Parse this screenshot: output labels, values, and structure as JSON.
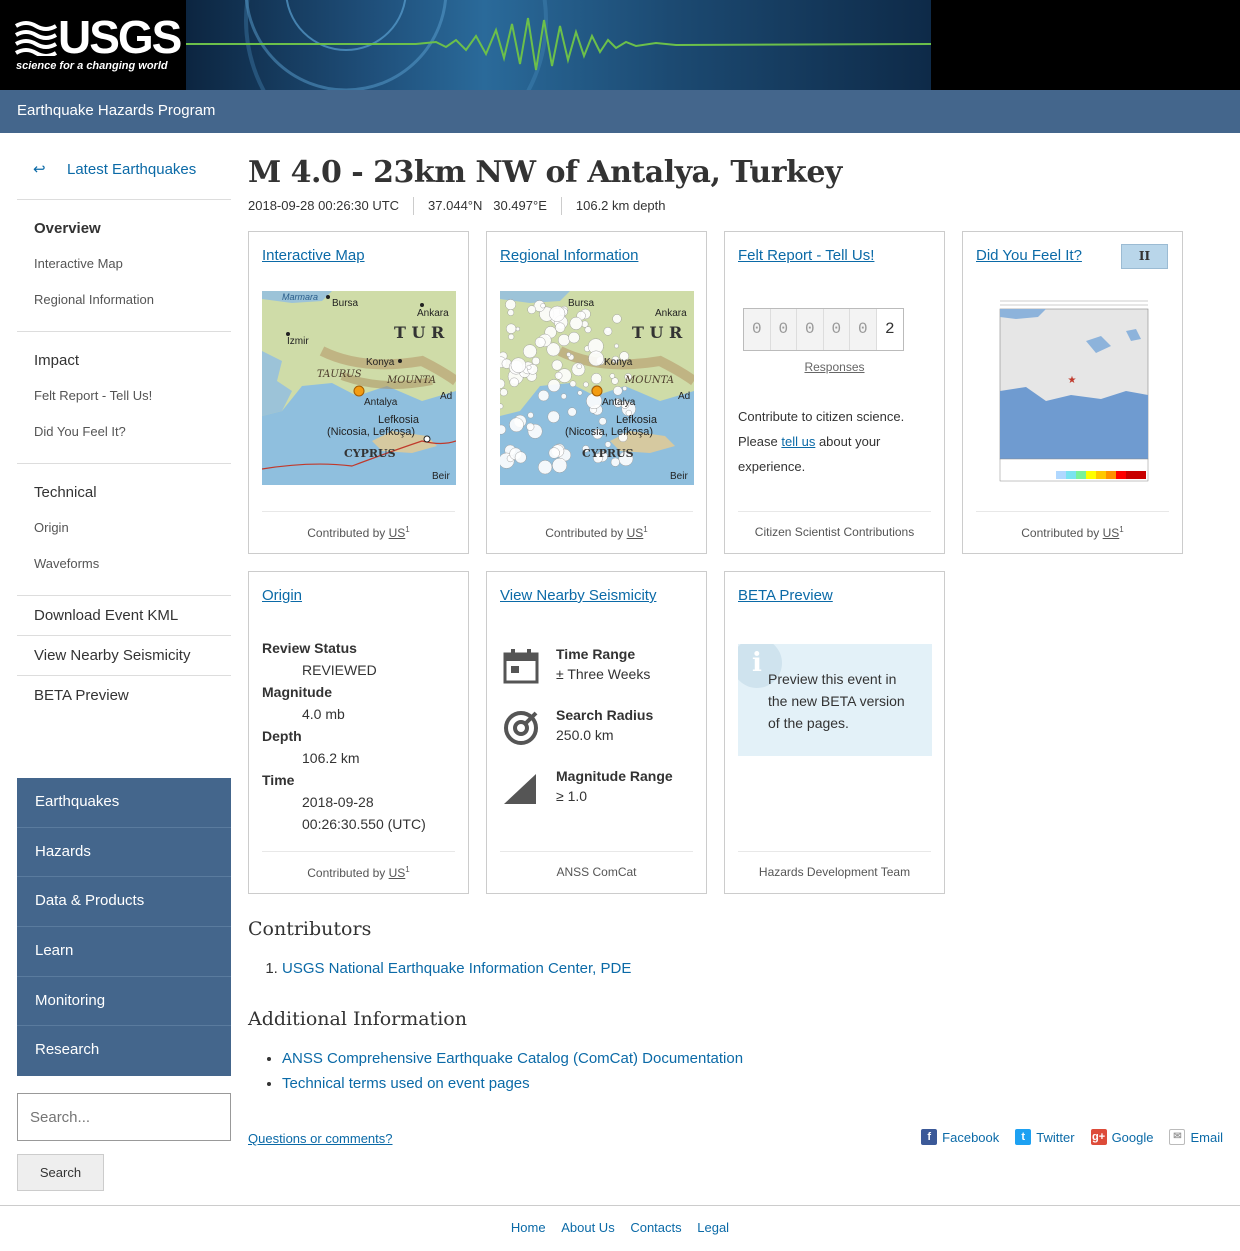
{
  "header": {
    "logo": "USGS",
    "tagline": "science for a changing world",
    "program": "Earthquake Hazards Program"
  },
  "sidebar": {
    "back_label": "Latest Earthquakes",
    "overview": "Overview",
    "overview_items": [
      "Interactive Map",
      "Regional Information"
    ],
    "impact": "Impact",
    "impact_items": [
      "Felt Report - Tell Us!",
      "Did You Feel It?"
    ],
    "technical": "Technical",
    "technical_items": [
      "Origin",
      "Waveforms"
    ],
    "download_kml": "Download Event KML",
    "nearby": "View Nearby Seismicity",
    "beta": "BETA Preview",
    "main_nav": [
      "Earthquakes",
      "Hazards",
      "Data & Products",
      "Learn",
      "Monitoring",
      "Research"
    ],
    "search_placeholder": "Search...",
    "search_button": "Search"
  },
  "event": {
    "title": "M 4.0 - 23km NW of Antalya, Turkey",
    "time": "2018-09-28 00:26:30 UTC",
    "location": "37.044°N   30.497°E",
    "depth": "106.2 km depth"
  },
  "cards": {
    "interactive_map": {
      "title": "Interactive Map",
      "footer_prefix": "Contributed by ",
      "footer_net": "US",
      "footer_sup": "1"
    },
    "regional": {
      "title": "Regional Information",
      "footer_prefix": "Contributed by ",
      "footer_net": "US",
      "footer_sup": "1"
    },
    "felt": {
      "title": "Felt Report - Tell Us!",
      "digits": [
        "0",
        "0",
        "0",
        "0",
        "0",
        "2"
      ],
      "responses_label": "Responses",
      "text_before": "Contribute to citizen science. Please ",
      "link": "tell us",
      "text_after": " about your experience.",
      "footer": "Citizen Scientist Contributions"
    },
    "dyfi": {
      "title": "Did You Feel It?",
      "badge": "II",
      "footer_prefix": "Contributed by ",
      "footer_net": "US",
      "footer_sup": "1"
    },
    "origin": {
      "title": "Origin",
      "review_label": "Review Status",
      "review_value": "REVIEWED",
      "mag_label": "Magnitude",
      "mag_value": "4.0 mb",
      "depth_label": "Depth",
      "depth_value": "106.2 km",
      "time_label": "Time",
      "time_value_1": "2018-09-28",
      "time_value_2": "00:26:30.550 (UTC)",
      "footer_prefix": "Contributed by ",
      "footer_net": "US",
      "footer_sup": "1"
    },
    "nearby": {
      "title": "View Nearby Seismicity",
      "time_range_label": "Time Range",
      "time_range_value": "± Three Weeks",
      "radius_label": "Search Radius",
      "radius_value": "250.0 km",
      "mag_range_label": "Magnitude Range",
      "mag_range_value": "≥ 1.0",
      "footer": "ANSS ComCat"
    },
    "beta": {
      "title": "BETA Preview",
      "text": "Preview this event in the new BETA version of the pages.",
      "footer": "Hazards Development Team"
    }
  },
  "map_labels": {
    "marmara": "Marmara",
    "bursa": "Bursa",
    "ankara": "Ankara",
    "izmir": "Izmir",
    "konya": "Konya",
    "tur": "T U R",
    "taurus": "TAURUS",
    "mountains": "MOUNTA",
    "antalya": "Antalya",
    "lefkosia": "Lefkosia",
    "nicosia": "(Nicosia, Lefkoşa)",
    "cyprus": "CYPRUS",
    "beirut": "Beir",
    "ad": "Ad"
  },
  "contributors": {
    "heading": "Contributors",
    "items": [
      "USGS National Earthquake Information Center, PDE"
    ]
  },
  "additional": {
    "heading": "Additional Information",
    "items": [
      "ANSS Comprehensive Earthquake Catalog (ComCat) Documentation",
      "Technical terms used on event pages"
    ]
  },
  "footer": {
    "questions": "Questions or comments?",
    "share": [
      "Facebook",
      "Twitter",
      "Google",
      "Email"
    ],
    "links": [
      "Home",
      "About Us",
      "Contacts",
      "Legal"
    ]
  },
  "colors": {
    "nav_blue": "#44668c",
    "link": "#0b6aa7",
    "dyfi_badge": "#b9d6ea",
    "beta_box": "#e3f1f8"
  }
}
